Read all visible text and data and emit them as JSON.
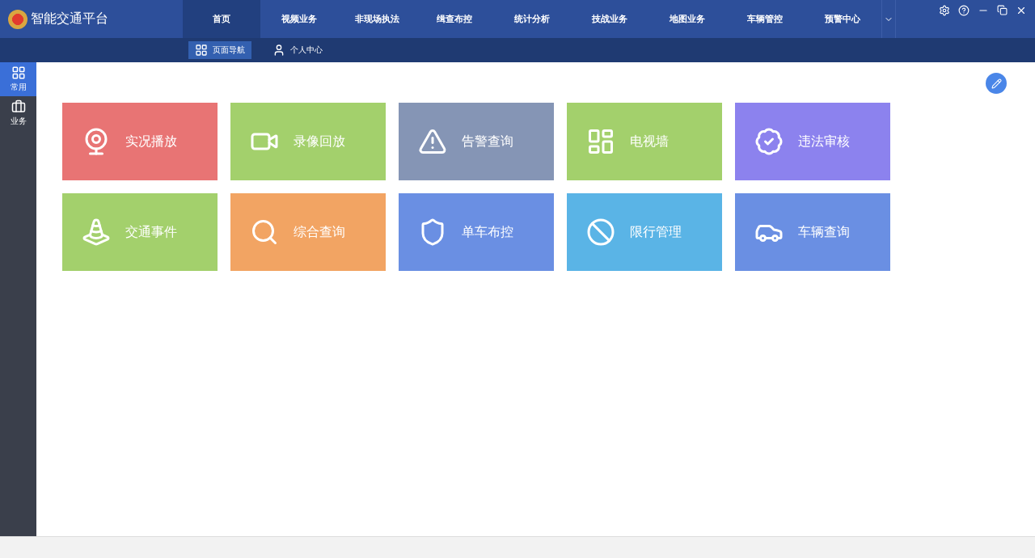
{
  "app": {
    "title": "智能交通平台"
  },
  "nav_tabs": [
    {
      "label": "首页",
      "selected": true
    },
    {
      "label": "视频业务",
      "selected": false
    },
    {
      "label": "非现场执法",
      "selected": false
    },
    {
      "label": "缉查布控",
      "selected": false
    },
    {
      "label": "统计分析",
      "selected": false
    },
    {
      "label": "技战业务",
      "selected": false
    },
    {
      "label": "地图业务",
      "selected": false
    },
    {
      "label": "车辆管控",
      "selected": false
    },
    {
      "label": "预警中心",
      "selected": false
    }
  ],
  "sub_tabs": [
    {
      "label": "页面导航",
      "kind": "grid",
      "selected": true
    },
    {
      "label": "个人中心",
      "kind": "user",
      "selected": false
    }
  ],
  "sidebar": {
    "items": [
      {
        "label": "常用",
        "kind": "grid",
        "selected": true
      },
      {
        "label": "业务",
        "kind": "briefcase",
        "selected": false
      }
    ]
  },
  "tiles": [
    {
      "label": "实况播放",
      "kind": "live",
      "color": "#e87474"
    },
    {
      "label": "录像回放",
      "kind": "video",
      "color": "#a3d06c"
    },
    {
      "label": "告警查询",
      "kind": "alert",
      "color": "#8595b5"
    },
    {
      "label": "电视墙",
      "kind": "wall",
      "color": "#a3d06c"
    },
    {
      "label": "违法审核",
      "kind": "star",
      "color": "#8c82ee"
    },
    {
      "label": "交通事件",
      "kind": "traffic",
      "color": "#a3d06c"
    },
    {
      "label": "综合查询",
      "kind": "search",
      "color": "#f2a463"
    },
    {
      "label": "单车布控",
      "kind": "shield",
      "color": "#6a8fe3"
    },
    {
      "label": "限行管理",
      "kind": "ban",
      "color": "#5ab4e6"
    },
    {
      "label": "车辆查询",
      "kind": "carsearch",
      "color": "#6a8fe3"
    }
  ]
}
